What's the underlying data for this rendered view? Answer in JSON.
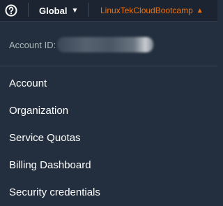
{
  "topbar": {
    "help_icon": "question-circle-icon",
    "region_label": "Global",
    "account_label": "LinuxTekCloudBootcamp"
  },
  "account_info": {
    "label": "Account ID:"
  },
  "menu": {
    "items": [
      {
        "label": "Account"
      },
      {
        "label": "Organization"
      },
      {
        "label": "Service Quotas"
      },
      {
        "label": "Billing Dashboard"
      },
      {
        "label": "Security credentials"
      }
    ]
  },
  "colors": {
    "background": "#232f3e",
    "topbar_background": "#1b2430",
    "accent": "#ec7211",
    "text": "#ffffff",
    "muted_text": "#aab7b8"
  }
}
